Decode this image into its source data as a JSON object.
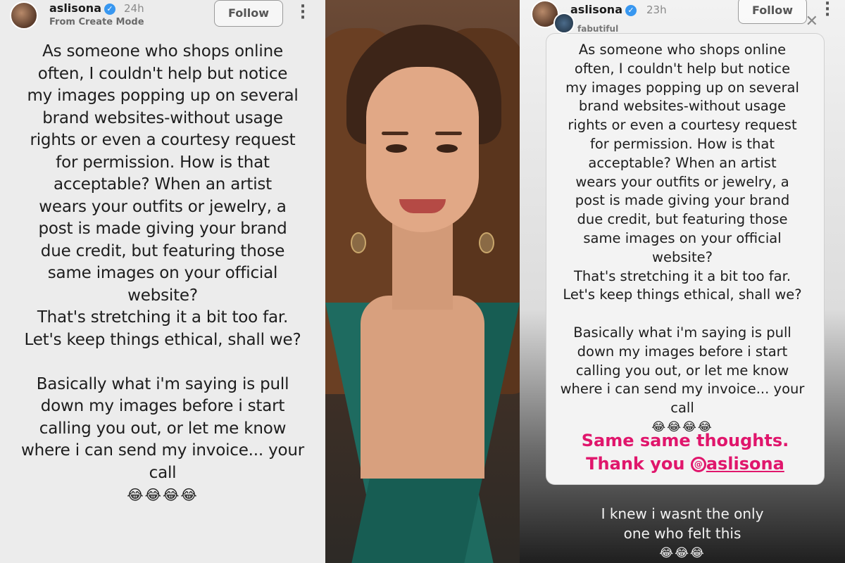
{
  "left_story": {
    "username": "aslisona",
    "verified_icon": "verified-badge-icon",
    "age": "24h",
    "subtitle": "From Create Mode",
    "follow_label": "Follow",
    "menu_icon": "more-vertical-icon",
    "lines": [
      "As someone who shops online",
      "often, I couldn't help but notice",
      "my images popping up on several",
      "brand websites-without usage",
      "rights or even a courtesy request",
      "for permission. How is that",
      "acceptable? When an artist",
      "wears your outfits or jewelry, a",
      "post is made giving your brand",
      "due credit, but featuring those",
      "same images on your official",
      "website?",
      "That's stretching it a bit too far.",
      "Let's keep things ethical, shall we?",
      "",
      "Basically what i'm saying is pull",
      "down my images before i start",
      "calling you out, or let me know",
      "where i can send my invoice... your",
      "call"
    ],
    "emoji": "😂😂😂😂"
  },
  "right_story": {
    "username": "aslisona",
    "age": "23h",
    "follow_label": "Follow",
    "shared_by": "fabutiful",
    "lines": [
      "As someone who shops online",
      "often, I couldn't help but notice",
      "my images popping up on several",
      "brand websites-without usage",
      "rights or even a courtesy request",
      "for permission. How is that",
      "acceptable? When an artist",
      "wears your outfits or jewelry, a",
      "post is made giving your brand",
      "due credit, but featuring those",
      "same images on your official",
      "website?",
      "That's stretching it a bit too far.",
      "Let's keep things ethical, shall we?",
      "",
      "Basically what i'm saying is pull",
      "down my images before i start",
      "calling you out, or let me know",
      "where i can send my invoice... your",
      "call"
    ],
    "emoji": "😂😂😂😂",
    "reply_line1": "Same same thoughts.",
    "reply_line2_prefix": "Thank you ",
    "mention": "aslisona",
    "caption_line1": "I knew i wasnt the only",
    "caption_line2": "one who felt this",
    "caption_emoji": "😂😂😂"
  },
  "colors": {
    "verified": "#3897f0",
    "reply_pink": "#e0166c",
    "dress_green": "#1e6b60"
  }
}
